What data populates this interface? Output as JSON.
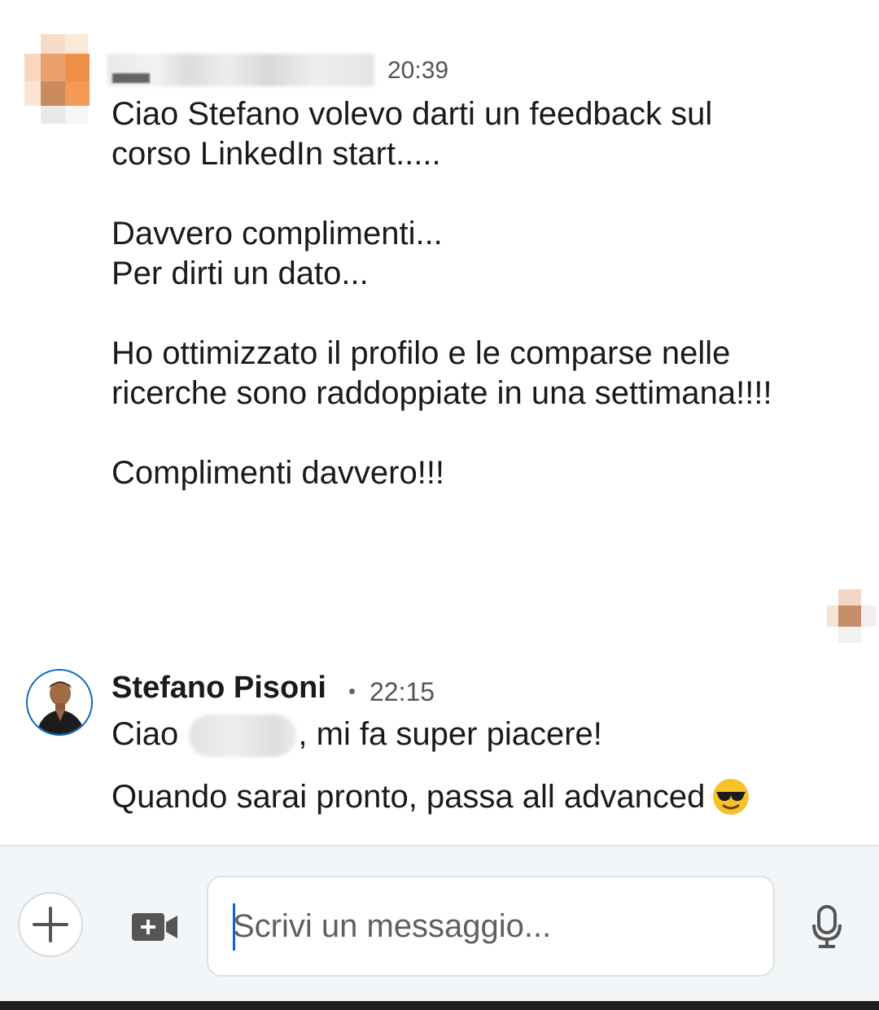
{
  "message1": {
    "time": "20:39",
    "paragraphs": [
      "Ciao Stefano volevo darti un feedback sul\ncorso LinkedIn start.....",
      "Davvero complimenti...\nPer dirti un dato...",
      "Ho ottimizzato il profilo e le comparse nelle\nricerche sono raddoppiate in una settimana!!!!",
      "Complimenti davvero!!!"
    ]
  },
  "message2": {
    "sender": "Stefano Pisoni",
    "separator": "•",
    "time": "22:15",
    "line1_prefix": "Ciao ",
    "line1_suffix": ", mi fa super piacere!",
    "line2": "Quando sarai pronto, passa all advanced",
    "emoji": "smiling-face-with-sunglasses"
  },
  "composer": {
    "placeholder": "Scrivi un messaggio..."
  },
  "colors": {
    "accent": "#0a66c2",
    "composer_bg": "#f3f6f8",
    "icon": "#555555"
  }
}
